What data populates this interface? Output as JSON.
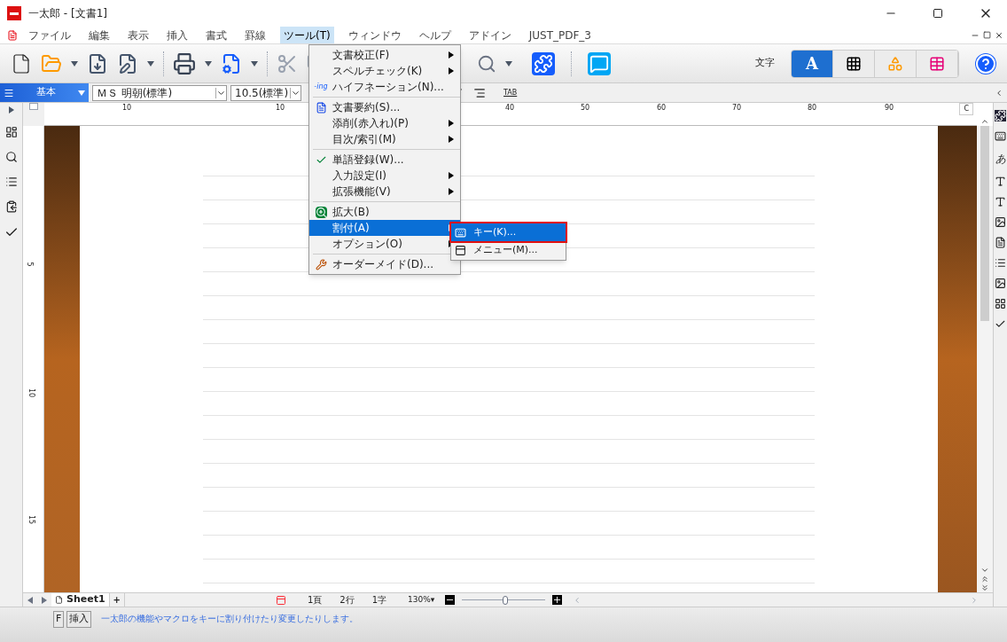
{
  "window": {
    "title": "一太郎 - [文書1]"
  },
  "menu_bar": [
    {
      "label": "ファイル",
      "selected": false
    },
    {
      "label": "編集",
      "selected": false
    },
    {
      "label": "表示",
      "selected": false
    },
    {
      "label": "挿入",
      "selected": false
    },
    {
      "label": "書式",
      "selected": false
    },
    {
      "label": "罫線",
      "selected": false
    },
    {
      "label": "ツール(T)",
      "selected": true
    },
    {
      "label": "ウィンドウ",
      "selected": false
    },
    {
      "label": "ヘルプ",
      "selected": false
    },
    {
      "label": "アドイン",
      "selected": false
    },
    {
      "label": "JUST_PDF_3",
      "selected": false
    }
  ],
  "toolbar": {
    "mode_label": "文字",
    "modes": [
      {
        "kind": "text",
        "label": "A",
        "selected": true
      },
      {
        "kind": "table",
        "selected": false
      },
      {
        "kind": "shape",
        "selected": false
      },
      {
        "kind": "layout",
        "selected": false
      }
    ]
  },
  "format_bar": {
    "style": "基本",
    "font": "ＭＳ 明朝(標準)",
    "size": "10.5(標準)",
    "tab": "TAB"
  },
  "ruler": {
    "numbers": [
      "10",
      "10",
      "40",
      "50",
      "60",
      "70",
      "80",
      "90"
    ],
    "end_mark": "C"
  },
  "vertical_ruler": [
    "5",
    "10",
    "15"
  ],
  "tools_menu": [
    {
      "kind": "item",
      "label": "文書校正(F)",
      "submenu": true,
      "selected": false
    },
    {
      "kind": "item",
      "label": "スペルチェック(K)",
      "submenu": true,
      "selected": false
    },
    {
      "kind": "item",
      "icon_text": "-ing",
      "label": "ハイフネーション(N)...",
      "submenu": false,
      "selected": false
    },
    {
      "kind": "separator"
    },
    {
      "kind": "item",
      "label": "文書要約(S)...",
      "submenu": false,
      "selected": false
    },
    {
      "kind": "item",
      "label": "添削(赤入れ)(P)",
      "submenu": true,
      "selected": false
    },
    {
      "kind": "item",
      "label": "目次/索引(M)",
      "submenu": true,
      "selected": false
    },
    {
      "kind": "separator"
    },
    {
      "kind": "item",
      "label": "単語登録(W)...",
      "submenu": false,
      "selected": false
    },
    {
      "kind": "item",
      "label": "入力設定(I)",
      "submenu": true,
      "selected": false
    },
    {
      "kind": "item",
      "label": "拡張機能(V)",
      "submenu": true,
      "selected": false
    },
    {
      "kind": "separator"
    },
    {
      "kind": "item",
      "label": "拡大(B)",
      "submenu": false,
      "selected": false
    },
    {
      "kind": "item",
      "label": "割付(A)",
      "submenu": true,
      "selected": true
    },
    {
      "kind": "item",
      "label": "オプション(O)",
      "submenu": true,
      "selected": false
    },
    {
      "kind": "separator"
    },
    {
      "kind": "item",
      "label": "オーダーメイド(D)...",
      "submenu": false,
      "selected": false
    }
  ],
  "assign_submenu": [
    {
      "label": "キー(K)...",
      "selected": true
    },
    {
      "label": "メニュー(M)...",
      "selected": false
    }
  ],
  "side_panel": {
    "kana": "あ"
  },
  "sheet_tab": {
    "label": "Sheet1",
    "add": "+"
  },
  "status": {
    "page": "1頁",
    "line": "2行",
    "char": "1字",
    "zoom": "130%▾",
    "zoom_slider": {
      "level": 0.52
    }
  },
  "status_bar": {
    "key": "F",
    "mode": "挿入",
    "message": "一太郎の機能やマクロをキーに割り付けたり変更したりします。"
  }
}
